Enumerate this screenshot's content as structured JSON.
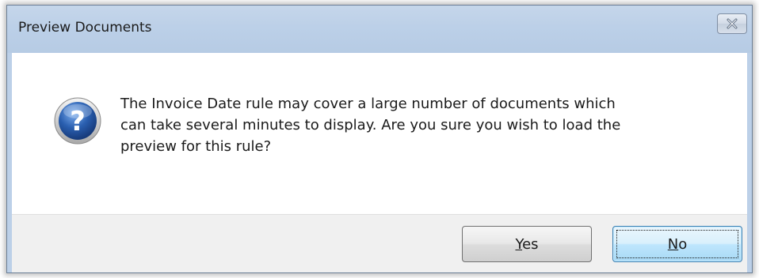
{
  "window": {
    "title": "Preview Documents"
  },
  "dialog": {
    "icon": "question-icon",
    "message": "The Invoice Date rule may cover a large number of documents which\ncan take several minutes to display.  Are you sure you wish to load the\npreview for this rule?"
  },
  "buttons": {
    "yes": {
      "mnemonic": "Y",
      "rest": "es"
    },
    "no": {
      "mnemonic": "N",
      "rest": "o"
    }
  },
  "icons": {
    "close": "close-icon",
    "question": "question-icon"
  },
  "colors": {
    "title_bar": "#bcd0e8",
    "question_icon": "#2a5fb0",
    "default_button_border": "#3c7fb1"
  }
}
